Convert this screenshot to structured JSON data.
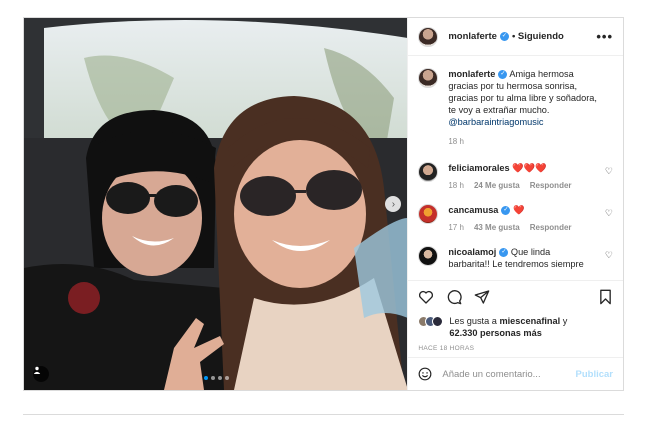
{
  "post": {
    "username": "monlaferte",
    "follow_label": "• Siguiendo",
    "more_label": "•••",
    "caption_user": "monlaferte",
    "caption_text": "Amiga hermosa gracias por tu hermosa sonrisa, gracias por tu alma libre y soñadora, te voy a extrañar mucho.",
    "caption_mention": "@barbaraintriagomusic",
    "caption_time": "18 h"
  },
  "comments": [
    {
      "user": "feliciamorales",
      "text": "❤️❤️❤️",
      "time": "18 h",
      "likes": "24 Me gusta",
      "reply": "Responder",
      "verified": false
    },
    {
      "user": "cancamusa",
      "text": "❤️",
      "time": "17 h",
      "likes": "43 Me gusta",
      "reply": "Responder",
      "verified": true
    },
    {
      "user": "nicoalamoj",
      "text": "Que linda",
      "overflow": "barbarita!! Le tendremos siempre",
      "verified": true
    }
  ],
  "likes": {
    "prefix": "Les gusta a",
    "first": "miescenafinal",
    "joiner": "y",
    "count": "62.330 personas más"
  },
  "timestamp": "HACE 18 HORAS",
  "composer": {
    "placeholder": "Añade un comentario...",
    "publish": "Publicar"
  },
  "icons": {
    "more": "more-options-icon",
    "verified": "verified-badge-icon",
    "like": "heart-icon",
    "comment": "comment-icon",
    "share": "share-icon",
    "save": "bookmark-icon",
    "emoji": "emoji-icon",
    "tag": "user-tag-icon"
  },
  "colors": {
    "accent": "#0095f6",
    "link": "#00376b",
    "muted": "#8e8e8e",
    "heart": "#ed4956"
  },
  "carousel": {
    "count": 4,
    "active": 1
  }
}
